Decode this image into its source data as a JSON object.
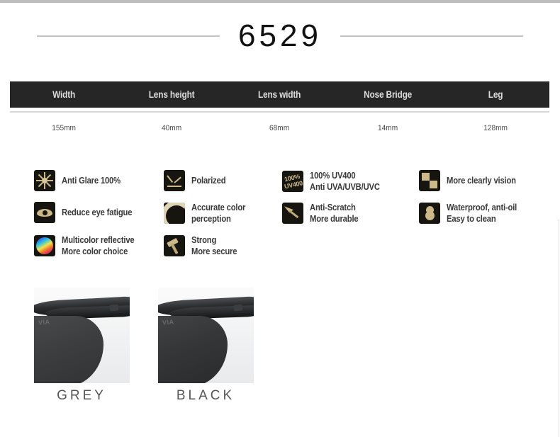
{
  "title": "6529",
  "spec_table": {
    "headers": [
      "Width",
      "Lens height",
      "Lens width",
      "Nose Bridge",
      "Leg"
    ],
    "values": [
      "155mm",
      "40mm",
      "68mm",
      "14mm",
      "128mm"
    ]
  },
  "features": [
    {
      "icon": "sunburst-icon",
      "line1": "Anti Glare 100%",
      "line2": ""
    },
    {
      "icon": "eye-icon",
      "line1": "Reduce eye fatigue",
      "line2": ""
    },
    {
      "icon": "rainbow-icon",
      "line1": "Multicolor reflective",
      "line2": "More color choice"
    },
    {
      "icon": "polarized-icon",
      "line1": "Polarized",
      "line2": ""
    },
    {
      "icon": "color-arc-icon",
      "line1": "Accurate color",
      "line2": "perception"
    },
    {
      "icon": "hammer-icon",
      "line1": "Strong",
      "line2": "More secure"
    },
    {
      "icon": "uv400-icon",
      "line1": "100% UV400",
      "line2": "Anti UVA/UVB/UVC"
    },
    {
      "icon": "anti-scratch-icon",
      "line1": "Anti-Scratch",
      "line2": "More durable"
    },
    {
      "icon": "checkerboard-icon",
      "line1": "More clearly vision",
      "line2": ""
    },
    {
      "icon": "droplet-icon",
      "line1": "Waterproof, anti-oil",
      "line2": "Easy to clean"
    }
  ],
  "uv_icon_text": {
    "top": "100%",
    "bottom": "UV400"
  },
  "colors": [
    {
      "name": "GREY"
    },
    {
      "name": "BLACK"
    }
  ],
  "palette": {
    "header_bar": "#262626",
    "icon_background": "#17150f",
    "icon_foreground": "#cbb98a",
    "rule": "#d8d8d8",
    "text": "#3a3a3a"
  }
}
